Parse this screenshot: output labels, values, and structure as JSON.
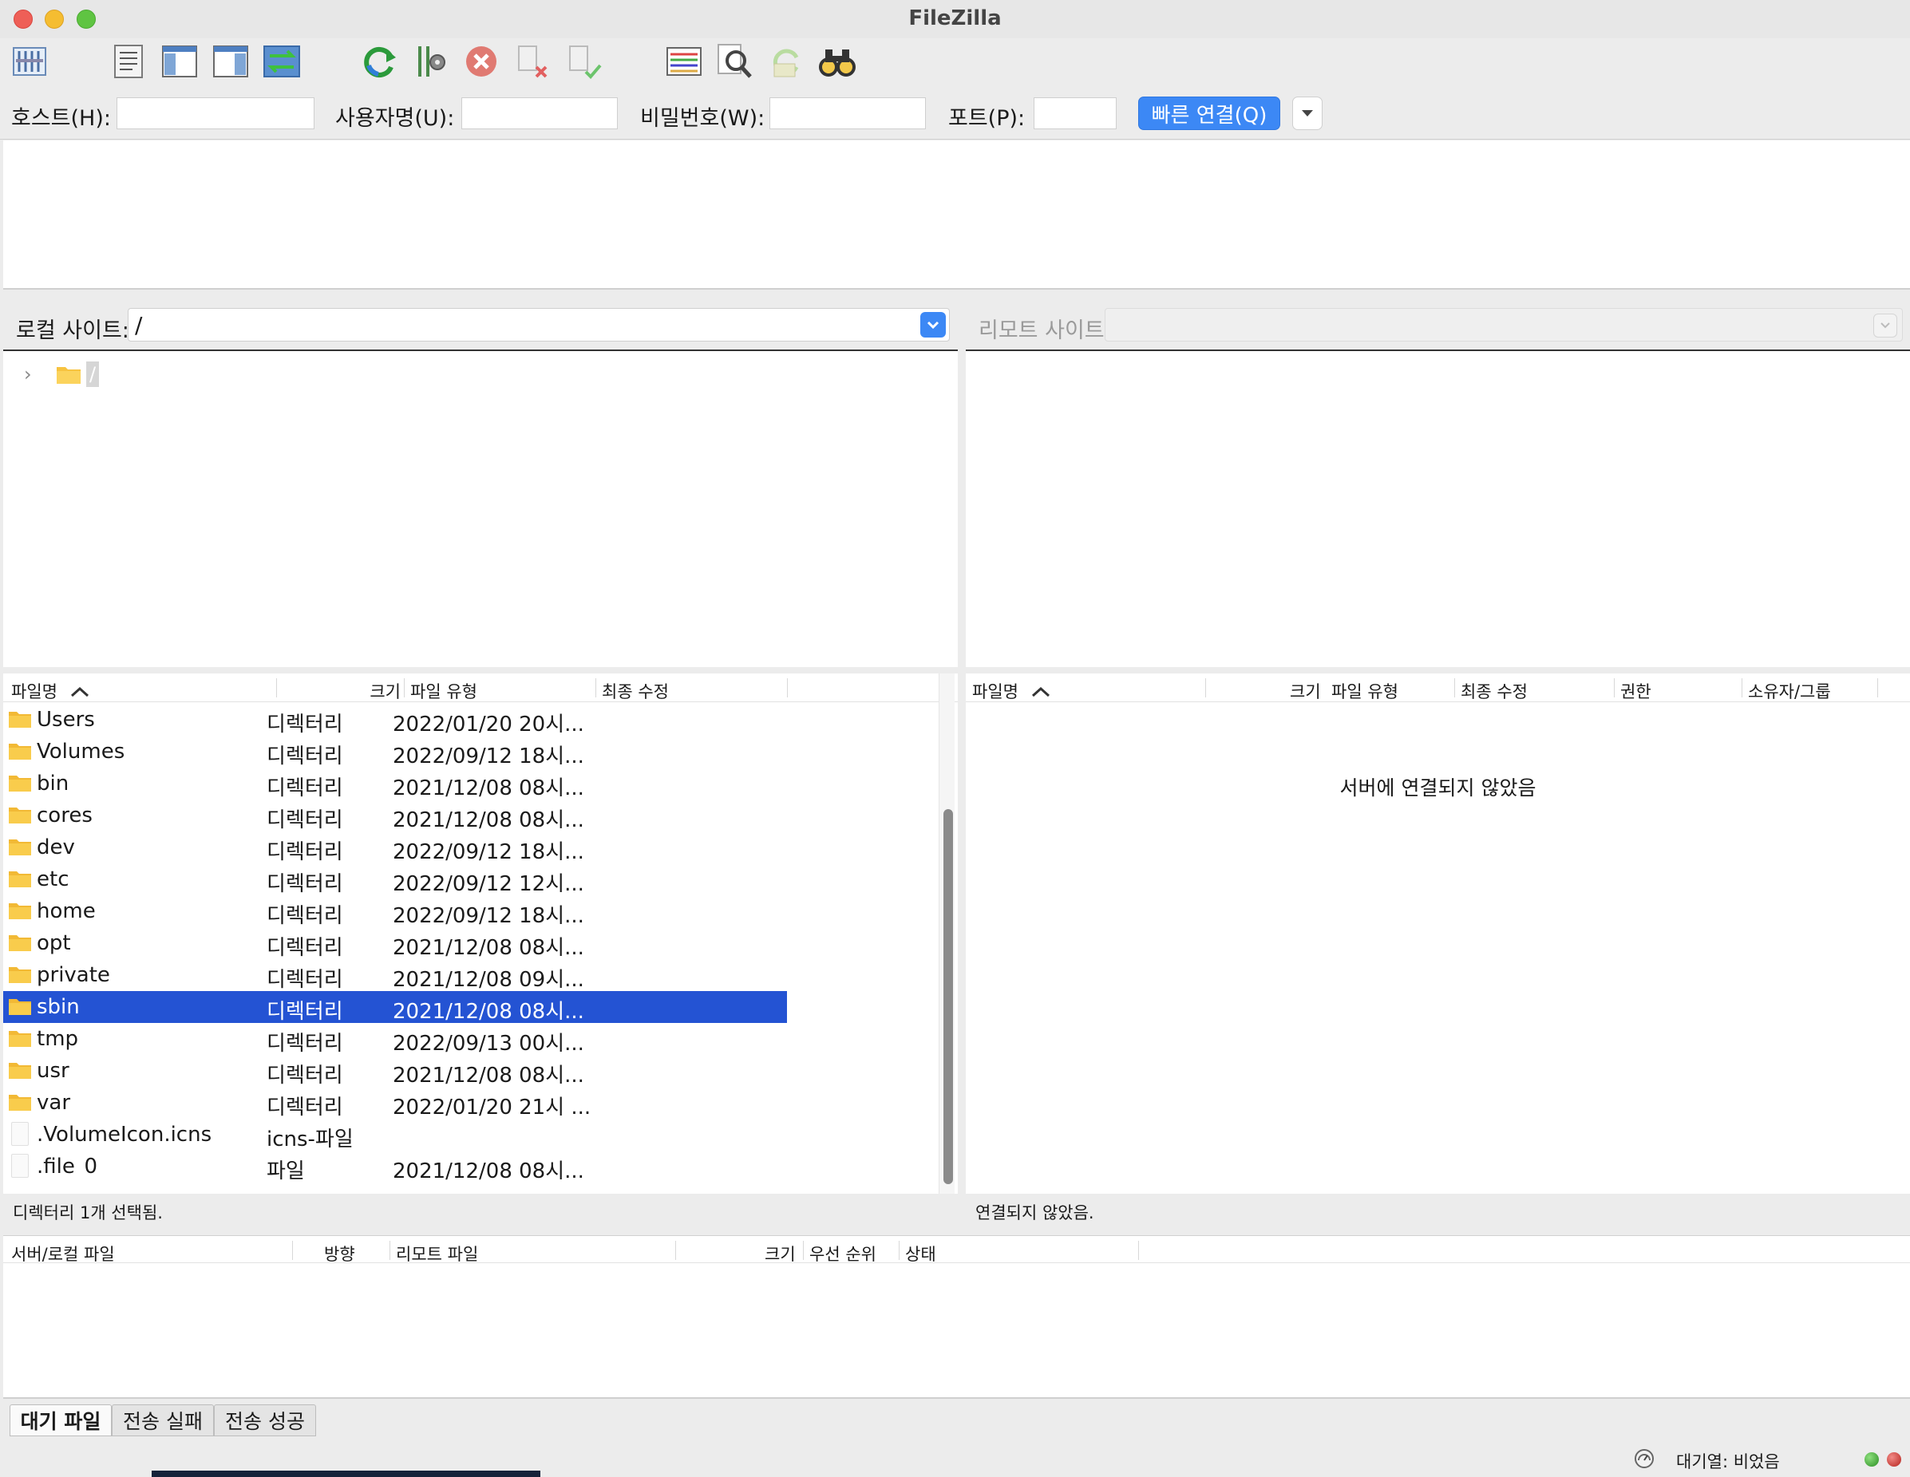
{
  "window": {
    "title": "FileZilla"
  },
  "toolbar": {
    "buttons": [
      {
        "icon": "site-manager-icon"
      },
      {
        "icon": "message-log-icon"
      },
      {
        "icon": "local-tree-icon"
      },
      {
        "icon": "remote-tree-icon"
      },
      {
        "icon": "transfer-queue-icon"
      },
      {
        "icon": "refresh-icon"
      },
      {
        "icon": "process-queue-icon"
      },
      {
        "icon": "cancel-icon"
      },
      {
        "icon": "disconnect-icon"
      },
      {
        "icon": "reconnect-icon"
      },
      {
        "icon": "filename-filter-icon"
      },
      {
        "icon": "search-files-icon"
      },
      {
        "icon": "sync-browsing-icon"
      },
      {
        "icon": "binoculars-icon"
      }
    ]
  },
  "quickconnect": {
    "host_label": "호스트(H):",
    "host_value": "",
    "user_label": "사용자명(U):",
    "user_value": "",
    "password_label": "비밀번호(W):",
    "password_value": "",
    "port_label": "포트(P):",
    "port_value": "",
    "connect_button": "빠른 연결(Q)"
  },
  "local": {
    "site_label": "로컬 사이트:",
    "path": "/",
    "tree_root": "/",
    "columns": {
      "name": "파일명",
      "size": "크기",
      "type": "파일 유형",
      "modified": "최종 수정"
    },
    "files": [
      {
        "name": "Users",
        "size": "",
        "type": "디렉터리",
        "modified": "2022/01/20 20시...",
        "kind": "folder"
      },
      {
        "name": "Volumes",
        "size": "",
        "type": "디렉터리",
        "modified": "2022/09/12 18시...",
        "kind": "folder"
      },
      {
        "name": "bin",
        "size": "",
        "type": "디렉터리",
        "modified": "2021/12/08 08시...",
        "kind": "folder"
      },
      {
        "name": "cores",
        "size": "",
        "type": "디렉터리",
        "modified": "2021/12/08 08시...",
        "kind": "folder"
      },
      {
        "name": "dev",
        "size": "",
        "type": "디렉터리",
        "modified": "2022/09/12 18시...",
        "kind": "folder"
      },
      {
        "name": "etc",
        "size": "",
        "type": "디렉터리",
        "modified": "2022/09/12 12시...",
        "kind": "folder"
      },
      {
        "name": "home",
        "size": "",
        "type": "디렉터리",
        "modified": "2022/09/12 18시...",
        "kind": "folder"
      },
      {
        "name": "opt",
        "size": "",
        "type": "디렉터리",
        "modified": "2021/12/08 08시...",
        "kind": "folder"
      },
      {
        "name": "private",
        "size": "",
        "type": "디렉터리",
        "modified": "2021/12/08 09시...",
        "kind": "folder"
      },
      {
        "name": "sbin",
        "size": "",
        "type": "디렉터리",
        "modified": "2021/12/08 08시...",
        "kind": "folder",
        "selected": true
      },
      {
        "name": "tmp",
        "size": "",
        "type": "디렉터리",
        "modified": "2022/09/13 00시...",
        "kind": "folder"
      },
      {
        "name": "usr",
        "size": "",
        "type": "디렉터리",
        "modified": "2021/12/08 08시...",
        "kind": "folder"
      },
      {
        "name": "var",
        "size": "",
        "type": "디렉터리",
        "modified": "2022/01/20 21시 ...",
        "kind": "folder"
      },
      {
        "name": ".VolumeIcon.icns",
        "size": "",
        "type": "icns-파일",
        "modified": "",
        "kind": "file"
      },
      {
        "name": ".file",
        "size": "0",
        "type": "파일",
        "modified": "2021/12/08 08시...",
        "kind": "file"
      }
    ],
    "status": "디렉터리 1개 선택됨."
  },
  "remote": {
    "site_label": "리모트 사이트:",
    "path": "",
    "columns": {
      "name": "파일명",
      "size": "크기",
      "type": "파일 유형",
      "modified": "최종 수정",
      "permissions": "권한",
      "owner": "소유자/그룹"
    },
    "empty_message": "서버에 연결되지 않았음",
    "status": "연결되지 않았음."
  },
  "queue": {
    "columns": {
      "local_file": "서버/로컬 파일",
      "direction": "방향",
      "remote_file": "리모트 파일",
      "size": "크기",
      "priority": "우선 순위",
      "status": "상태"
    },
    "tabs": [
      "대기 파일",
      "전송 실패",
      "전송 성공"
    ],
    "active_tab": 0
  },
  "statusbar": {
    "queue": "대기열: 비었음"
  },
  "colors": {
    "accent": "#3c88f5",
    "selection": "#2453d3",
    "folder": "#f7c340"
  }
}
